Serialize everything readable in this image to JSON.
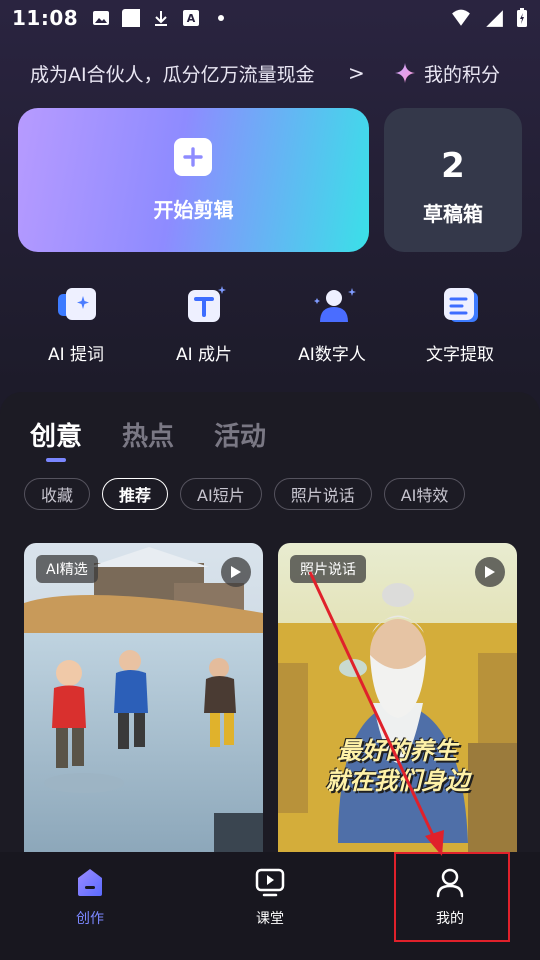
{
  "status_bar": {
    "time": "11:08"
  },
  "promo": {
    "text": "成为AI合伙人，瓜分亿万流量现金",
    "chevron": ">",
    "points_label": "我的积分"
  },
  "start_card": {
    "label": "开始剪辑"
  },
  "draft_card": {
    "count": "2",
    "label": "草稿箱"
  },
  "tools": [
    {
      "label": "AI 提词",
      "icon": "teleprompter-icon"
    },
    {
      "label": "AI 成片",
      "icon": "ai-film-icon"
    },
    {
      "label": "AI数字人",
      "icon": "digital-human-icon"
    },
    {
      "label": "文字提取",
      "icon": "text-extract-icon"
    }
  ],
  "tabs": [
    {
      "label": "创意",
      "active": true
    },
    {
      "label": "热点",
      "active": false
    },
    {
      "label": "活动",
      "active": false
    }
  ],
  "chips": [
    {
      "label": "收藏",
      "active": false
    },
    {
      "label": "推荐",
      "active": true
    },
    {
      "label": "AI短片",
      "active": false
    },
    {
      "label": "照片说话",
      "active": false
    },
    {
      "label": "AI特效",
      "active": false
    }
  ],
  "feed": [
    {
      "badge": "AI精选"
    },
    {
      "badge": "照片说话",
      "caption_line1": "最好的养生",
      "caption_line2": "就在我们身边"
    }
  ],
  "bottom_nav": [
    {
      "label": "创作",
      "active": true
    },
    {
      "label": "课堂",
      "active": false
    },
    {
      "label": "我的",
      "active": false
    }
  ],
  "colors": {
    "accent": "#7b87ff",
    "annotation": "#e0212b"
  }
}
